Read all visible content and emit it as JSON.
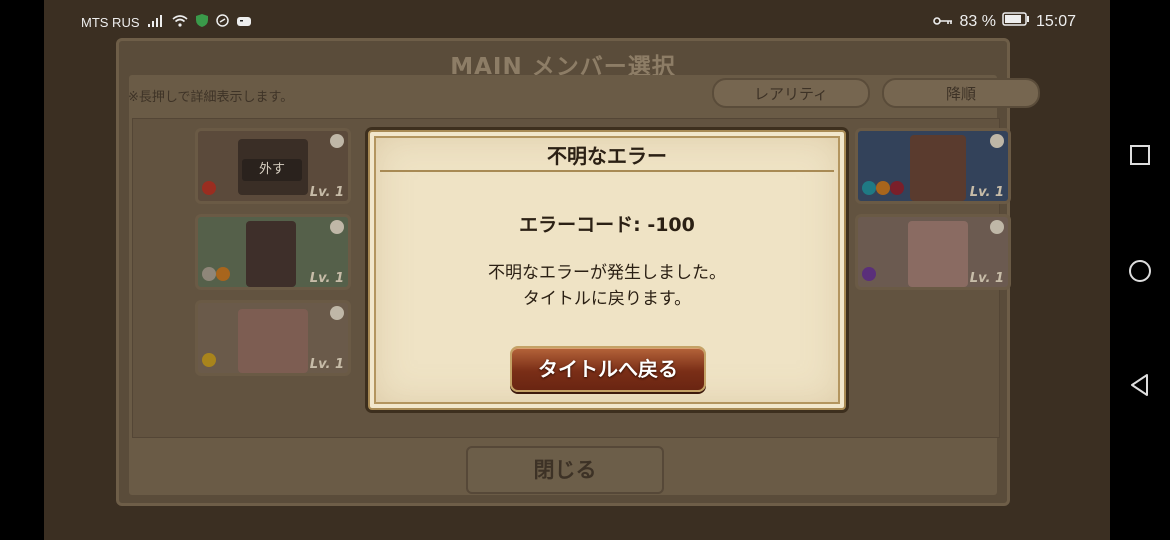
{
  "status_bar": {
    "carrier": "MTS RUS",
    "battery_percent": "83 %",
    "time": "15:07"
  },
  "panel": {
    "title": "MAIN メンバー選択",
    "hint": "※長押しで詳細表示します。",
    "sort_rarity_label": "レアリティ",
    "sort_order_label": "降順",
    "close_label": "閉じる",
    "remove_label": "外す",
    "cards": [
      {
        "level": "Lv. 1"
      },
      {
        "level": "Lv. 1"
      },
      {
        "level": "Lv. 1"
      },
      {
        "level": "Lv. 1"
      },
      {
        "level": "Lv. 1"
      }
    ]
  },
  "dialog": {
    "title": "不明なエラー",
    "error_code": "エラーコード: -100",
    "message_line1": "不明なエラーが発生しました。",
    "message_line2": "タイトルに戻ります。",
    "button_label": "タイトルへ戻る"
  },
  "colors": {
    "dialog_bg": "#efe3c5",
    "button_red": "#7a2e17",
    "dim_overlay": "#3b2f22"
  }
}
